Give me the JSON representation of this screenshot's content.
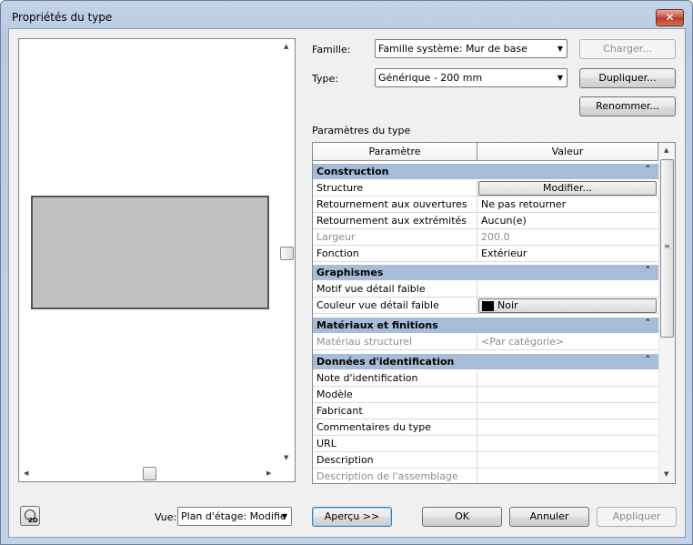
{
  "window": {
    "title": "Propriétés du type",
    "close_glyph": "✕"
  },
  "header": {
    "famille_label": "Famille:",
    "famille_value": "Famille système: Mur de base",
    "type_label": "Type:",
    "type_value": "Générique - 200 mm",
    "charger_label": "Charger...",
    "dupliquer_label": "Dupliquer...",
    "renommer_label": "Renommer...",
    "parametres_label": "Paramètres du type"
  },
  "grid": {
    "col_parametre": "Paramètre",
    "col_valeur": "Valeur",
    "sections": [
      {
        "title": "Construction"
      },
      {
        "title": "Graphismes"
      },
      {
        "title": "Matériaux et finitions"
      },
      {
        "title": "Données d'identification"
      }
    ],
    "rows": [
      {
        "param": "Structure",
        "value": "Modifier..."
      },
      {
        "param": "Retournement aux ouvertures",
        "value": "Ne pas retourner"
      },
      {
        "param": "Retournement aux extrémités",
        "value": "Aucun(e)"
      },
      {
        "param": "Largeur",
        "value": "200.0"
      },
      {
        "param": "Fonction",
        "value": "Extérieur"
      },
      {
        "param": "Motif vue détail faible",
        "value": ""
      },
      {
        "param": "Couleur vue détail faible",
        "value": "Noir"
      },
      {
        "param": "Matériau structurel",
        "value": "<Par catégorie>"
      },
      {
        "param": "Note d'identification",
        "value": ""
      },
      {
        "param": "Modèle",
        "value": ""
      },
      {
        "param": "Fabricant",
        "value": ""
      },
      {
        "param": "Commentaires du type",
        "value": ""
      },
      {
        "param": "URL",
        "value": ""
      },
      {
        "param": "Description",
        "value": ""
      },
      {
        "param": "Description de l'assemblage",
        "value": ""
      }
    ],
    "collapse_glyph": "⌃"
  },
  "footer": {
    "vue_label": "Vue:",
    "vue_value": "Plan d'étage: Modifie",
    "apercu_label": "Aperçu >>",
    "ok_label": "OK",
    "annuler_label": "Annuler",
    "appliquer_label": "Appliquer",
    "icon_2d_text": "2D"
  },
  "colors": {
    "section_bg": "#a7bcd6",
    "swatch": "#000000"
  }
}
